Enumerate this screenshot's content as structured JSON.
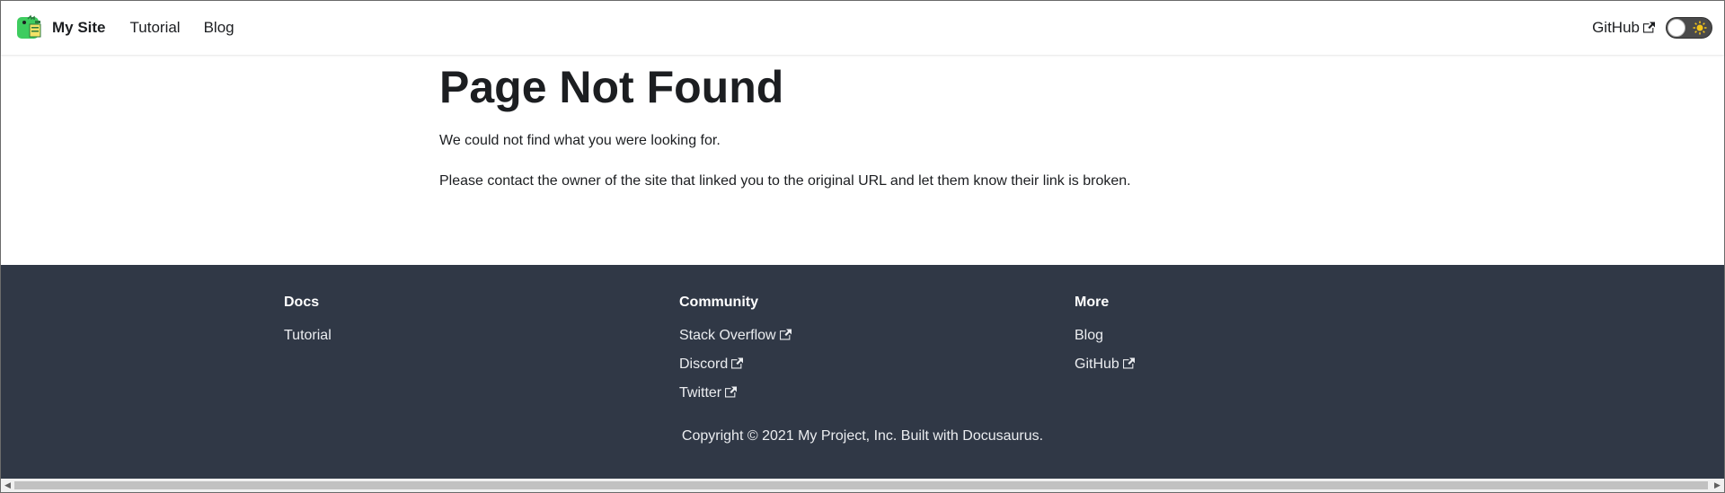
{
  "navbar": {
    "brand": "My Site",
    "links": [
      "Tutorial",
      "Blog"
    ],
    "github": "GitHub"
  },
  "main": {
    "title": "Page Not Found",
    "line1": "We could not find what you were looking for.",
    "line2": "Please contact the owner of the site that linked you to the original URL and let them know their link is broken."
  },
  "footer": {
    "columns": [
      {
        "title": "Docs",
        "links": [
          "Tutorial"
        ]
      },
      {
        "title": "Community",
        "links": [
          "Stack Overflow",
          "Discord",
          "Twitter"
        ]
      },
      {
        "title": "More",
        "links": [
          "Blog",
          "GitHub"
        ]
      }
    ],
    "copyright": "Copyright © 2021 My Project, Inc. Built with Docusaurus."
  },
  "colors": {
    "footer_bg": "#303846",
    "logo_green": "#3ecc5f",
    "toggle_bg": "#4a4a4a",
    "sun": "#f5c518"
  },
  "icons": [
    "dinosaur-logo-icon",
    "external-link-icon",
    "sun-icon"
  ]
}
